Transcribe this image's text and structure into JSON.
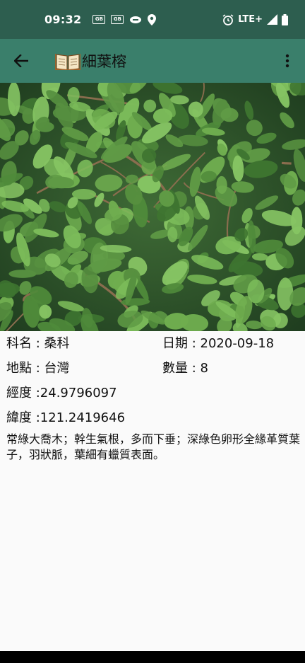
{
  "status_bar": {
    "time": "09:32",
    "badge_1": "GB",
    "badge_2": "GB",
    "network": "LTE+"
  },
  "app_bar": {
    "title": "細葉榕",
    "back_icon": "arrow-left-icon",
    "menu_icon": "more-vert-icon",
    "book_icon": "open-book-icon"
  },
  "details": {
    "family": "科名 : 桑科",
    "date": "日期 : 2020-09-18",
    "location": "地點 : 台灣",
    "quantity": "數量 : 8",
    "longitude": "經度 :24.9796097",
    "latitude": "緯度 :121.2419646",
    "description": "常綠大喬木；幹生氣根，多而下垂；深綠色卵形全緣革質葉子，羽狀脈，葉細有蠟質表面。"
  },
  "colors": {
    "status_bar": "#2d5e4f",
    "app_bar": "#3a7f6b",
    "background": "#fafafa"
  }
}
